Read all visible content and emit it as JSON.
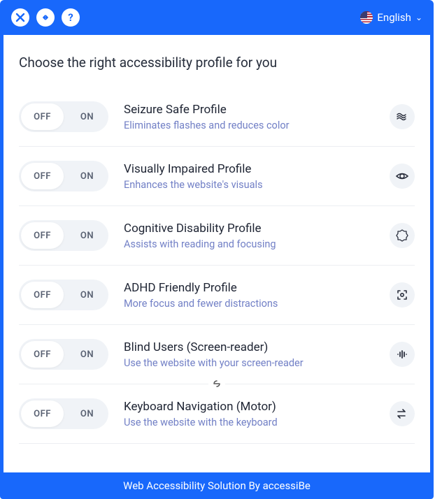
{
  "header": {
    "language_label": "English"
  },
  "heading": "Choose the right accessibility profile for you",
  "toggle": {
    "off": "OFF",
    "on": "ON"
  },
  "profiles": [
    {
      "title": "Seizure Safe Profile",
      "desc": "Eliminates flashes and reduces color",
      "icon": "wave"
    },
    {
      "title": "Visually Impaired Profile",
      "desc": "Enhances the website's visuals",
      "icon": "eye"
    },
    {
      "title": "Cognitive Disability Profile",
      "desc": "Assists with reading and focusing",
      "icon": "badge"
    },
    {
      "title": "ADHD Friendly Profile",
      "desc": "More focus and fewer distractions",
      "icon": "target"
    },
    {
      "title": "Blind Users (Screen-reader)",
      "desc": "Use the website with your screen-reader",
      "icon": "audio",
      "link_below": true
    },
    {
      "title": "Keyboard Navigation (Motor)",
      "desc": "Use the website with the keyboard",
      "icon": "swap"
    }
  ],
  "footer": "Web Accessibility Solution By accessiBe"
}
